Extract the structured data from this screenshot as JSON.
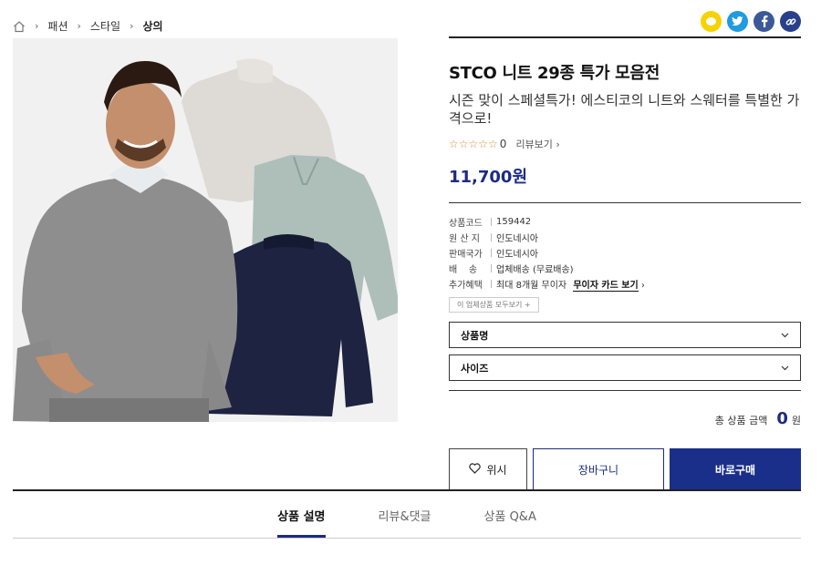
{
  "breadcrumb": {
    "items": [
      "패션",
      "스타일",
      "상의"
    ]
  },
  "product": {
    "title": "STCO 니트 29종 특가 모음전",
    "subtitle": "시즌 맞이 스페셜특가! 에스티코의 니트와 스웨터를 특별한 가격으로!",
    "rating_stars": "☆☆☆☆☆",
    "review_count": "0",
    "review_link": "리뷰보기 ›",
    "price": "11,700원"
  },
  "specs": {
    "code_label": "상품코드",
    "code_value": "159442",
    "origin_label": "원 산 지",
    "origin_value": "인도네시아",
    "country_label": "판매국가",
    "country_value": "인도네시아",
    "shipping_label": "배    송",
    "shipping_value": "업체배송 (무료배송)",
    "benefit_label": "추가혜택",
    "benefit_value": "최대 8개월 무이자",
    "benefit_link": "무이자 카드 보기",
    "benefit_chevron": "›",
    "more_sellers": "이 업체상품 모두보기 +"
  },
  "options": {
    "product_name": "상품명",
    "size": "사이즈"
  },
  "total": {
    "label": "총 상품 금액",
    "amount": "0",
    "unit": "원"
  },
  "buttons": {
    "wish": "위시",
    "cart": "장바구니",
    "buy": "바로구매"
  },
  "tabs": [
    "상품 설명",
    "리뷰&댓글",
    "상품 Q&A"
  ],
  "colors": {
    "accent": "#1c2b84",
    "star": "#e08a3c"
  }
}
